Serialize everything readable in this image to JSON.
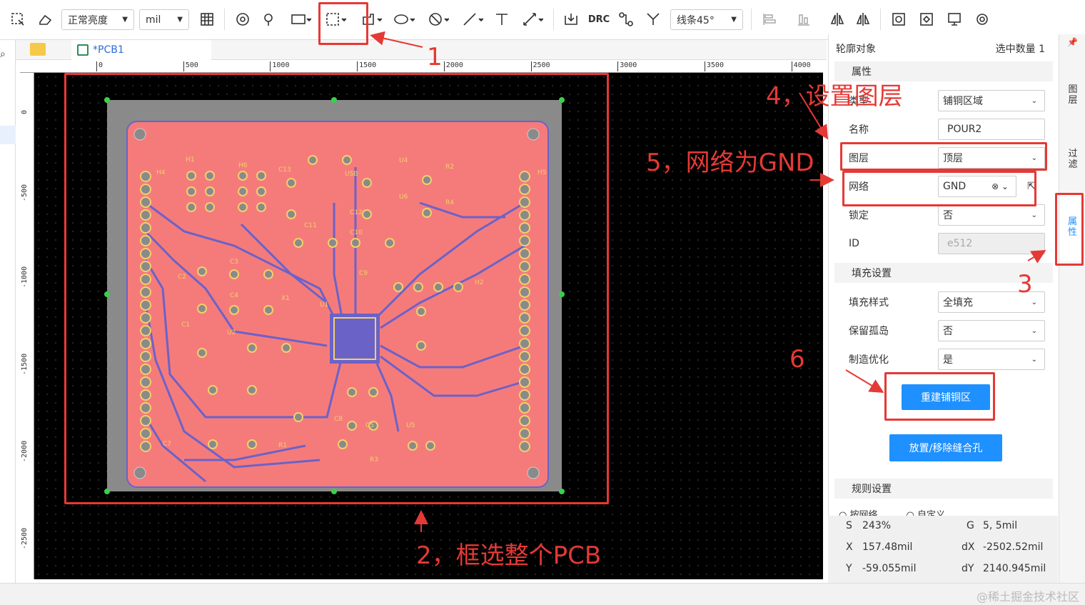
{
  "toolbar": {
    "brightness": "正常亮度",
    "unit": "mil",
    "drc": "DRC",
    "line_mode": "线条45°"
  },
  "tabs": {
    "doc": "*PCB1"
  },
  "ruler": {
    "top": [
      "0",
      "500",
      "1000",
      "1500",
      "2000",
      "2500",
      "3000",
      "3500",
      "4000"
    ],
    "left": [
      "0",
      "-500",
      "-1000",
      "-1500",
      "-2000",
      "-2500"
    ]
  },
  "panel": {
    "header_left": "轮廓对象",
    "header_right": "选中数量  1",
    "section_props": "属性",
    "type_label": "类型",
    "type_value": "铺铜区域",
    "name_label": "名称",
    "name_value": "POUR2",
    "layer_label": "图层",
    "layer_value": "顶层",
    "net_label": "网络",
    "net_value": "GND",
    "lock_label": "锁定",
    "lock_value": "否",
    "id_label": "ID",
    "id_value": "e512",
    "section_fill": "填充设置",
    "fill_style_label": "填充样式",
    "fill_style_value": "全填充",
    "keep_island_label": "保留孤岛",
    "keep_island_value": "否",
    "mfg_opt_label": "制造优化",
    "mfg_opt_value": "是",
    "rebuild_button": "重建铺铜区",
    "stitch_button": "放置/移除缝合孔",
    "section_rules": "规则设置",
    "rule_opt1": "按网络",
    "rule_opt2": "自定义"
  },
  "stats": {
    "s_label": "S",
    "s_value": "243%",
    "g_label": "G",
    "g_value": "5, 5mil",
    "x_label": "X",
    "x_value": "157.48mil",
    "dx_label": "dX",
    "dx_value": "-2502.52mil",
    "y_label": "Y",
    "y_value": "-59.055mil",
    "dy_label": "dY",
    "dy_value": "2140.945mil"
  },
  "right_tabs": {
    "layers": "图层",
    "filter": "过滤",
    "props": "属性"
  },
  "annotations": {
    "a1": "1",
    "a2": "2，框选整个PCB",
    "a3": "3",
    "a4": "4，设置图层",
    "a5": "5，网络为GND",
    "a6": "6"
  },
  "pcb_labels": [
    "H1",
    "H6",
    "C13",
    "U4",
    "R2",
    "U6",
    "R4",
    "H4",
    "H5",
    "C12",
    "C11",
    "C10",
    "C3",
    "C4",
    "X1",
    "C2",
    "C1",
    "U2",
    "C9",
    "U1",
    "H2",
    "C8",
    "C5",
    "U5",
    "R3",
    "R1",
    "C7",
    "USB"
  ],
  "watermark": "@稀土掘金技术社区",
  "colors": {
    "accent": "#1e90ff",
    "annotation": "#e53935",
    "copper": "#f57b7b",
    "silk": "#f2d06b",
    "trace": "#6b62c8"
  }
}
